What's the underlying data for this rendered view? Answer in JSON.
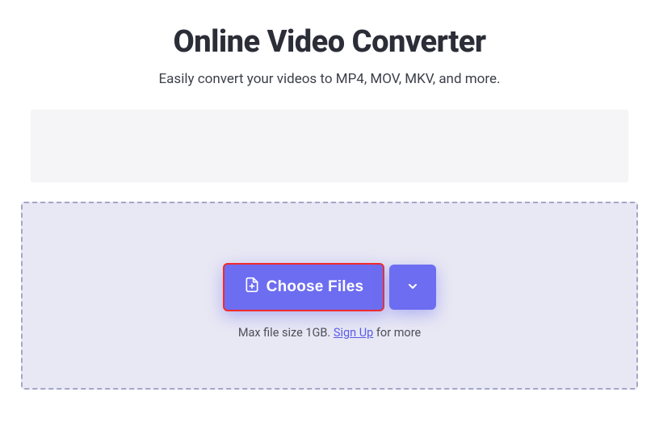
{
  "header": {
    "title": "Online Video Converter",
    "subtitle": "Easily convert your videos to MP4, MOV, MKV, and more."
  },
  "dropzone": {
    "choose_label": "Choose Files",
    "hint_prefix": "Max file size 1GB. ",
    "signup_label": "Sign Up",
    "hint_suffix": " for more"
  },
  "colors": {
    "accent": "#6d6df1",
    "highlight_border": "#f02b2b",
    "dropzone_bg": "#e8e8f4",
    "dropzone_border": "#a5a5c8"
  }
}
